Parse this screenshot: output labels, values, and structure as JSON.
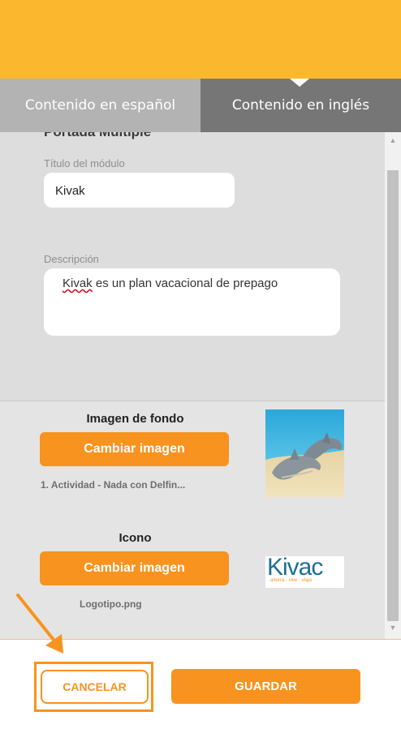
{
  "tabs": {
    "spanish": "Contenido en español",
    "english": "Contenido en inglés"
  },
  "form": {
    "section_title": "Portada Múltiple",
    "title_label": "Título del módulo",
    "title_value": "Kivak",
    "description_label": "Descripción",
    "description_value_word": "Kivak",
    "description_value_rest": " es un plan vacacional de prepago"
  },
  "background_image": {
    "label": "Imagen de fondo",
    "button": "Cambiar imagen",
    "file_name": "1. Actividad - Nada con Delfin..."
  },
  "icon_image": {
    "label": "Icono",
    "button": "Cambiar imagen",
    "file_name": "Logotipo.png",
    "logo_text": "Kivac",
    "logo_tagline": "ahorra · vive · viaja"
  },
  "footer": {
    "cancel": "CANCELAR",
    "save": "GUARDAR"
  },
  "colors": {
    "header": "#fbb82e",
    "accent": "#f7931e",
    "tab_active": "#767676",
    "tab_inactive": "#b3b3b3"
  }
}
